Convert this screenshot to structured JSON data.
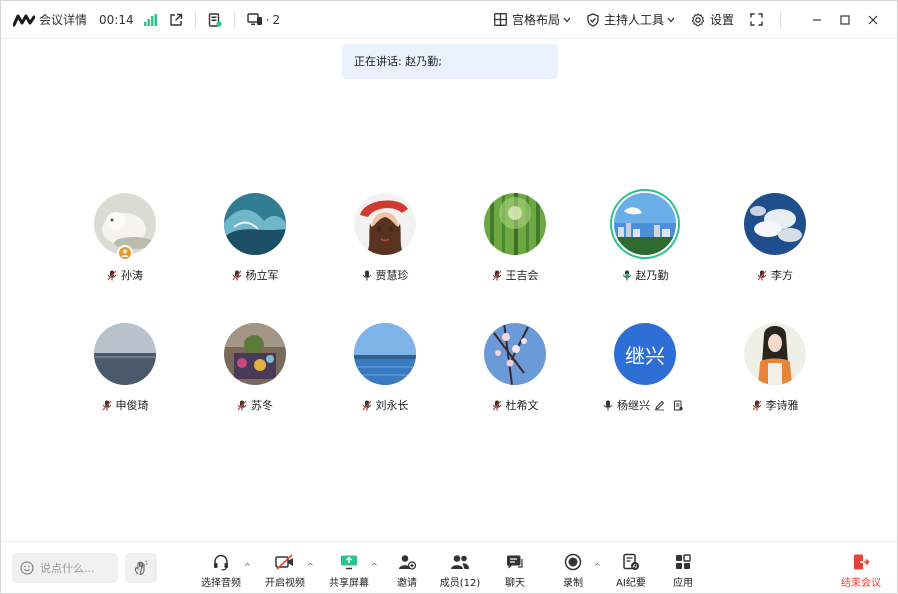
{
  "topbar": {
    "meeting_info_label": "会议详情",
    "timer": "00:14",
    "device_count": "2",
    "layout_label": "宫格布局",
    "host_tools_label": "主持人工具",
    "settings_label": "设置"
  },
  "speaker_banner": {
    "text": "正在讲话: 赵乃勤;"
  },
  "participants": [
    {
      "name": "孙涛",
      "mic": "muted",
      "host": true
    },
    {
      "name": "杨立军",
      "mic": "muted"
    },
    {
      "name": "贾慧珍",
      "mic": "on"
    },
    {
      "name": "王吉会",
      "mic": "muted"
    },
    {
      "name": "赵乃勤",
      "mic": "speaking",
      "active": true
    },
    {
      "name": "李方",
      "mic": "muted"
    },
    {
      "name": "申俊琦",
      "mic": "muted"
    },
    {
      "name": "苏冬",
      "mic": "muted"
    },
    {
      "name": "刘永长",
      "mic": "muted"
    },
    {
      "name": "杜希文",
      "mic": "muted"
    },
    {
      "name": "杨继兴",
      "mic": "on",
      "avatar_text": "继兴",
      "extra_icons": [
        "pen-icon",
        "document-icon"
      ]
    },
    {
      "name": "李诗雅",
      "mic": "muted"
    }
  ],
  "bottombar": {
    "chat_placeholder": "说点什么...",
    "audio_label": "选择音频",
    "video_label": "开启视频",
    "share_label": "共享屏幕",
    "invite_label": "邀请",
    "members_label": "成员(12)",
    "chat_label": "聊天",
    "record_label": "录制",
    "ai_notes_label": "AI纪要",
    "apps_label": "应用",
    "end_label": "结束会议"
  },
  "colors": {
    "accent_green": "#2cc38b",
    "banner_bg": "#e9f1fd",
    "end_red": "#e5443a",
    "host_badge": "#f0962b",
    "avatar_blue": "#2e6fd6"
  }
}
